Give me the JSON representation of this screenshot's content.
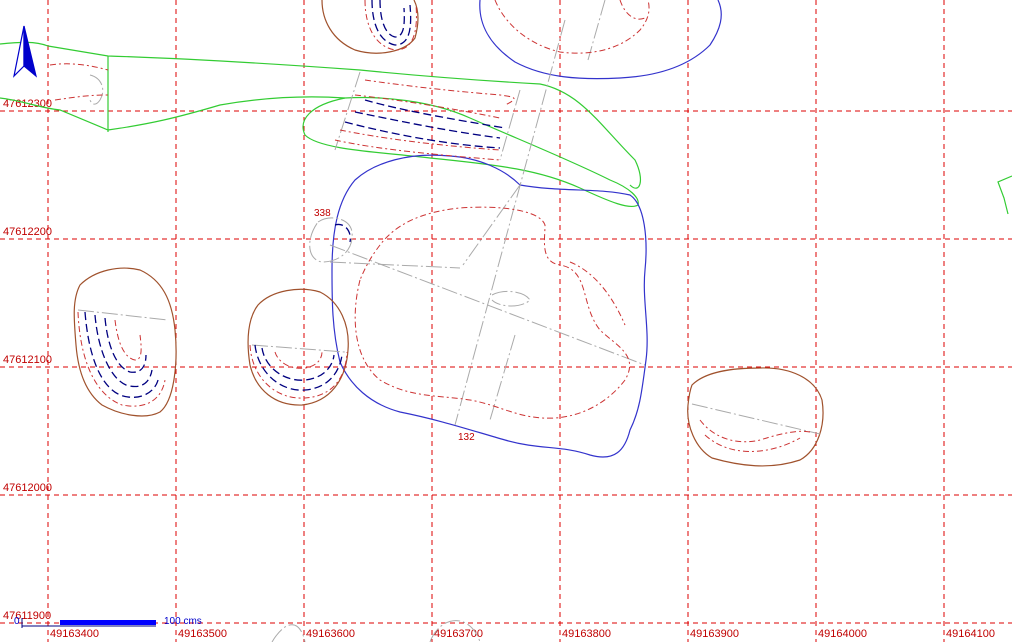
{
  "map": {
    "grid_x_labels": [
      "49163400",
      "49163500",
      "49163600",
      "49163700",
      "49163800",
      "49163900",
      "49164000",
      "49164100"
    ],
    "grid_y_labels": [
      "47612300",
      "47612200",
      "47612100",
      "47612000",
      "47611900"
    ],
    "feature_labels": {
      "label_338": "338",
      "label_132": "132"
    },
    "scale_bar": {
      "zero": "0",
      "label": "100 cms"
    },
    "north_arrow": {
      "icon": "north-arrow-icon"
    },
    "colors": {
      "grid": "#dd0000",
      "contour_dashed": "#cc3333",
      "contour_dark": "#000080",
      "outline_blue": "#3333cc",
      "outline_brown": "#a0522d",
      "outline_green": "#33cc33",
      "axis_gray": "#aaaaaa",
      "north_arrow": "#0000cc"
    }
  }
}
